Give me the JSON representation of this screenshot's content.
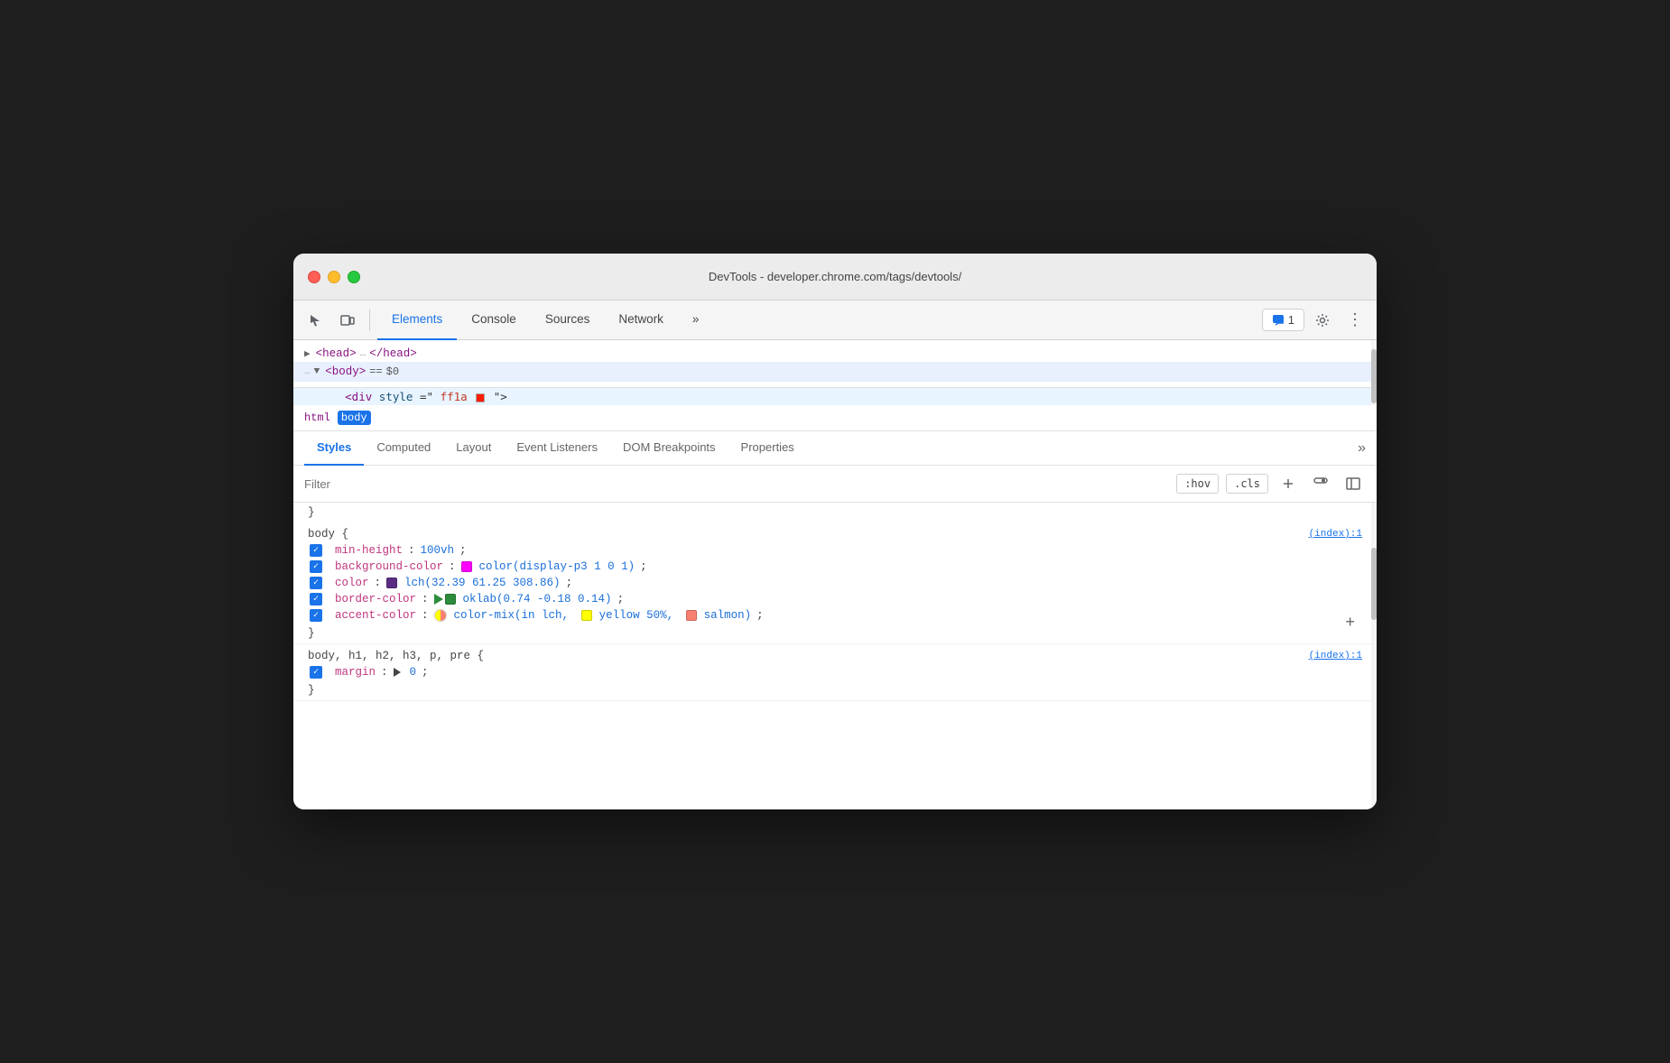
{
  "window": {
    "title": "DevTools - developer.chrome.com/tags/devtools/"
  },
  "toolbar": {
    "tabs": [
      "Elements",
      "Console",
      "Sources",
      "Network"
    ],
    "more_label": "»",
    "notification_count": "1",
    "settings_label": "⚙",
    "more_options_label": "⋮"
  },
  "dom": {
    "head_line": "▶ <head> … </head>",
    "body_line": "… ▼ <body> == $0"
  },
  "breadcrumb": {
    "items": [
      "html",
      "body"
    ]
  },
  "styles_panel": {
    "tabs": [
      "Styles",
      "Computed",
      "Layout",
      "Event Listeners",
      "DOM Breakpoints",
      "Properties"
    ],
    "more_label": "»"
  },
  "filter": {
    "placeholder": "Filter",
    "hov_label": ":hov",
    "cls_label": ".cls",
    "add_label": "+"
  },
  "css_rules": [
    {
      "id": "rule-brace-close",
      "type": "brace-close",
      "content": "}"
    },
    {
      "id": "rule-body",
      "selector": "body {",
      "source": "(index):1",
      "properties": [
        {
          "name": "min-height",
          "value": "100vh;",
          "checked": true,
          "color_swatch": null
        },
        {
          "name": "background-color",
          "value": "color(display-p3 1 0 1);",
          "checked": true,
          "color_swatch": "#ff00ff",
          "swatch_type": "solid"
        },
        {
          "name": "color",
          "value": "lch(32.39 61.25 308.86);",
          "checked": true,
          "color_swatch": "#5a2d82",
          "swatch_type": "solid"
        },
        {
          "name": "border-color",
          "value": "oklab(0.74 -0.18 0.14);",
          "checked": true,
          "color_swatch": "#2d8c3c",
          "swatch_type": "triangle-solid"
        },
        {
          "name": "accent-color",
          "value": "color-mix(in lch, yellow 50%,  salmon);",
          "checked": true,
          "color_swatch_left": "#ffff00",
          "color_swatch_right": "#fa8072",
          "swatch_type": "color-mix"
        }
      ]
    },
    {
      "id": "rule-body-headings",
      "selector": "body, h1, h2, h3, p, pre {",
      "source": "(index):1",
      "properties": [
        {
          "name": "margin",
          "value": "0;",
          "checked": true,
          "has_triangle": true
        }
      ]
    }
  ],
  "colors": {
    "accent": "#1a73e8",
    "active_tab_border": "#1a73e8",
    "property_name": "#c0357e",
    "property_value": "#1a6ed8"
  }
}
